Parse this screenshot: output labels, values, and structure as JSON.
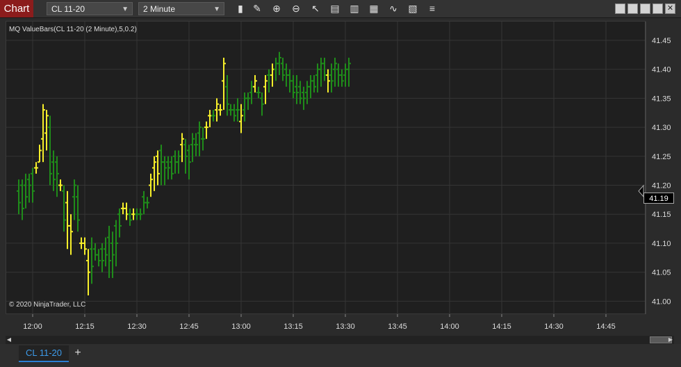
{
  "toolbar": {
    "chart_label": "Chart",
    "instrument": "CL 11-20",
    "interval": "2 Minute",
    "icons": [
      "bar-type-icon",
      "draw-pencil-icon",
      "zoom-in-icon",
      "zoom-out-icon",
      "pointer-icon",
      "data-box-icon",
      "templates-icon",
      "strategies-icon",
      "indicators-icon",
      "properties-icon",
      "menu-icon"
    ]
  },
  "chart": {
    "indicator_label": "MQ ValueBars(CL 11-20 (2 Minute),5,0.2)",
    "copyright": "© 2020 NinjaTrader, LLC",
    "last_price_label": "41.19",
    "colors": {
      "background": "#1f1f1f",
      "grid": "#353535",
      "green": "#1f8c1a",
      "yellow": "#f7ef2a",
      "red": "#d41c1c",
      "text": "#dddddd"
    }
  },
  "chart_data": {
    "type": "bar",
    "y_ticks": [
      "41.45",
      "41.40",
      "41.35",
      "41.30",
      "41.25",
      "41.20",
      "41.15",
      "41.10",
      "41.05",
      "41.00"
    ],
    "x_ticks": [
      "12:00",
      "12:15",
      "12:30",
      "12:45",
      "13:00",
      "13:15",
      "13:30",
      "13:45",
      "14:00",
      "14:15",
      "14:30",
      "14:45"
    ],
    "ylim": [
      41.0,
      41.48
    ],
    "last_price": 41.19,
    "bars": [
      [
        "11:56",
        41.21,
        41.19,
        41.15,
        41.17,
        "g"
      ],
      [
        "11:57",
        41.21,
        41.2,
        41.14,
        41.16,
        "g"
      ],
      [
        "11:58",
        41.22,
        41.2,
        41.16,
        41.18,
        "g"
      ],
      [
        "11:59",
        41.22,
        41.21,
        41.17,
        41.2,
        "g"
      ],
      [
        "12:00",
        41.23,
        41.22,
        41.17,
        41.19,
        "g"
      ],
      [
        "12:01",
        41.24,
        41.23,
        41.22,
        41.23,
        "y"
      ],
      [
        "12:02",
        41.27,
        41.24,
        41.24,
        41.26,
        "y"
      ],
      [
        "12:03",
        41.34,
        41.28,
        41.24,
        41.33,
        "y"
      ],
      [
        "12:04",
        41.33,
        41.29,
        41.26,
        41.32,
        "y"
      ],
      [
        "12:05",
        41.32,
        41.3,
        41.2,
        41.22,
        "g"
      ],
      [
        "12:06",
        41.26,
        41.24,
        41.19,
        41.21,
        "g"
      ],
      [
        "12:07",
        41.25,
        41.24,
        41.18,
        41.22,
        "g"
      ],
      [
        "12:08",
        41.21,
        41.2,
        41.19,
        41.2,
        "y"
      ],
      [
        "12:09",
        41.2,
        41.19,
        41.12,
        41.14,
        "g"
      ],
      [
        "12:10",
        41.19,
        41.17,
        41.09,
        41.13,
        "y"
      ],
      [
        "12:11",
        41.15,
        41.13,
        41.08,
        41.12,
        "y"
      ],
      [
        "12:12",
        41.21,
        41.18,
        41.14,
        41.2,
        "g"
      ],
      [
        "12:13",
        41.2,
        41.18,
        41.12,
        41.14,
        "g"
      ],
      [
        "12:14",
        41.11,
        41.1,
        41.09,
        41.1,
        "y"
      ],
      [
        "12:15",
        41.11,
        41.1,
        41.08,
        41.09,
        "y"
      ],
      [
        "12:16",
        41.09,
        41.07,
        41.01,
        41.05,
        "y"
      ],
      [
        "12:17",
        41.11,
        41.09,
        41.03,
        41.06,
        "g"
      ],
      [
        "12:18",
        41.1,
        41.09,
        41.07,
        41.08,
        "g"
      ],
      [
        "12:19",
        41.09,
        41.08,
        41.06,
        41.07,
        "g"
      ],
      [
        "12:20",
        41.1,
        41.09,
        41.05,
        41.07,
        "g"
      ],
      [
        "12:21",
        41.11,
        41.09,
        41.06,
        41.08,
        "g"
      ],
      [
        "12:22",
        41.13,
        41.11,
        41.04,
        41.07,
        "g"
      ],
      [
        "12:23",
        41.12,
        41.1,
        41.04,
        41.08,
        "g"
      ],
      [
        "12:24",
        41.14,
        41.13,
        41.06,
        41.1,
        "g"
      ],
      [
        "12:25",
        41.16,
        41.15,
        41.11,
        41.13,
        "g"
      ],
      [
        "12:26",
        41.17,
        41.16,
        41.15,
        41.16,
        "y"
      ],
      [
        "12:27",
        41.17,
        41.16,
        41.14,
        41.15,
        "y"
      ],
      [
        "12:28",
        41.16,
        41.15,
        41.13,
        41.14,
        "g"
      ],
      [
        "12:29",
        41.16,
        41.15,
        41.14,
        41.15,
        "y"
      ],
      [
        "12:30",
        41.16,
        41.15,
        41.14,
        41.15,
        "g"
      ],
      [
        "12:31",
        41.16,
        41.15,
        41.14,
        41.15,
        "g"
      ],
      [
        "12:32",
        41.19,
        41.18,
        41.15,
        41.17,
        "g"
      ],
      [
        "12:33",
        41.18,
        41.17,
        41.16,
        41.17,
        "g"
      ],
      [
        "12:34",
        41.22,
        41.2,
        41.18,
        41.21,
        "y"
      ],
      [
        "12:35",
        41.25,
        41.23,
        41.19,
        41.24,
        "y"
      ],
      [
        "12:36",
        41.26,
        41.25,
        41.2,
        41.22,
        "y"
      ],
      [
        "12:37",
        41.27,
        41.26,
        41.2,
        41.24,
        "g"
      ],
      [
        "12:38",
        41.25,
        41.24,
        41.2,
        41.23,
        "g"
      ],
      [
        "12:39",
        41.25,
        41.24,
        41.21,
        41.23,
        "g"
      ],
      [
        "12:40",
        41.25,
        41.24,
        41.21,
        41.22,
        "g"
      ],
      [
        "12:41",
        41.26,
        41.25,
        41.22,
        41.24,
        "g"
      ],
      [
        "12:42",
        41.26,
        41.24,
        41.22,
        41.25,
        "g"
      ],
      [
        "12:43",
        41.29,
        41.27,
        41.24,
        41.28,
        "y"
      ],
      [
        "12:44",
        41.28,
        41.27,
        41.22,
        41.25,
        "g"
      ],
      [
        "12:45",
        41.27,
        41.26,
        41.21,
        41.24,
        "g"
      ],
      [
        "12:46",
        41.29,
        41.27,
        41.24,
        41.28,
        "g"
      ],
      [
        "12:47",
        41.29,
        41.27,
        41.25,
        41.27,
        "g"
      ],
      [
        "12:48",
        41.31,
        41.29,
        41.25,
        41.3,
        "g"
      ],
      [
        "12:49",
        41.3,
        41.28,
        41.26,
        41.28,
        "g"
      ],
      [
        "12:50",
        41.31,
        41.3,
        41.28,
        41.3,
        "y"
      ],
      [
        "12:51",
        41.33,
        41.32,
        41.3,
        41.32,
        "y"
      ],
      [
        "12:52",
        41.33,
        41.32,
        41.31,
        41.32,
        "g"
      ],
      [
        "12:53",
        41.35,
        41.33,
        41.31,
        41.34,
        "y"
      ],
      [
        "12:54",
        41.34,
        41.33,
        41.32,
        41.33,
        "y"
      ],
      [
        "12:55",
        41.42,
        41.38,
        41.33,
        41.41,
        "y"
      ],
      [
        "12:56",
        41.39,
        41.37,
        41.32,
        41.34,
        "g"
      ],
      [
        "12:57",
        41.34,
        41.33,
        41.32,
        41.33,
        "g"
      ],
      [
        "12:58",
        41.34,
        41.33,
        41.31,
        41.32,
        "g"
      ],
      [
        "12:59",
        41.35,
        41.33,
        41.31,
        41.33,
        "g"
      ],
      [
        "13:00",
        41.34,
        41.31,
        41.29,
        41.32,
        "y"
      ],
      [
        "13:01",
        41.36,
        41.33,
        41.31,
        41.35,
        "g"
      ],
      [
        "13:02",
        41.36,
        41.35,
        41.33,
        41.35,
        "g"
      ],
      [
        "13:03",
        41.38,
        41.36,
        41.34,
        41.37,
        "g"
      ],
      [
        "13:04",
        41.39,
        41.37,
        41.36,
        41.38,
        "y"
      ],
      [
        "13:05",
        41.37,
        41.36,
        41.35,
        41.36,
        "g"
      ],
      [
        "13:06",
        41.36,
        41.35,
        41.32,
        41.34,
        "g"
      ],
      [
        "13:07",
        41.39,
        41.37,
        41.34,
        41.38,
        "y"
      ],
      [
        "13:08",
        41.4,
        41.39,
        41.36,
        41.39,
        "g"
      ],
      [
        "13:09",
        41.41,
        41.39,
        41.37,
        41.4,
        "y"
      ],
      [
        "13:10",
        41.42,
        41.4,
        41.38,
        41.41,
        "g"
      ],
      [
        "13:11",
        41.43,
        41.41,
        41.39,
        41.42,
        "g"
      ],
      [
        "13:12",
        41.42,
        41.41,
        41.38,
        41.39,
        "g"
      ],
      [
        "13:13",
        41.41,
        41.4,
        41.37,
        41.39,
        "g"
      ],
      [
        "13:14",
        41.4,
        41.39,
        41.36,
        41.38,
        "g"
      ],
      [
        "13:15",
        41.39,
        41.38,
        41.35,
        41.36,
        "g"
      ],
      [
        "13:16",
        41.39,
        41.37,
        41.34,
        41.36,
        "g"
      ],
      [
        "13:17",
        41.38,
        41.37,
        41.34,
        41.35,
        "g"
      ],
      [
        "13:18",
        41.37,
        41.36,
        41.33,
        41.35,
        "g"
      ],
      [
        "13:19",
        41.38,
        41.36,
        41.34,
        41.37,
        "g"
      ],
      [
        "13:20",
        41.39,
        41.37,
        41.35,
        41.38,
        "g"
      ],
      [
        "13:21",
        41.39,
        41.38,
        41.36,
        41.37,
        "g"
      ],
      [
        "13:22",
        41.41,
        41.39,
        41.36,
        41.4,
        "g"
      ],
      [
        "13:23",
        41.42,
        41.4,
        41.37,
        41.41,
        "g"
      ],
      [
        "13:24",
        41.42,
        41.41,
        41.38,
        41.39,
        "g"
      ],
      [
        "13:25",
        41.4,
        41.39,
        41.36,
        41.38,
        "y"
      ],
      [
        "13:26",
        41.41,
        41.39,
        41.36,
        41.38,
        "g"
      ],
      [
        "13:27",
        41.42,
        41.4,
        41.37,
        41.41,
        "g"
      ],
      [
        "13:28",
        41.41,
        41.4,
        41.37,
        41.39,
        "g"
      ],
      [
        "13:29",
        41.4,
        41.39,
        41.37,
        41.38,
        "g"
      ],
      [
        "13:30",
        41.41,
        41.39,
        41.37,
        41.4,
        "g"
      ],
      [
        "13:31",
        41.42,
        41.4,
        41.37,
        41.41,
        "g"
      ]
    ]
  }
}
